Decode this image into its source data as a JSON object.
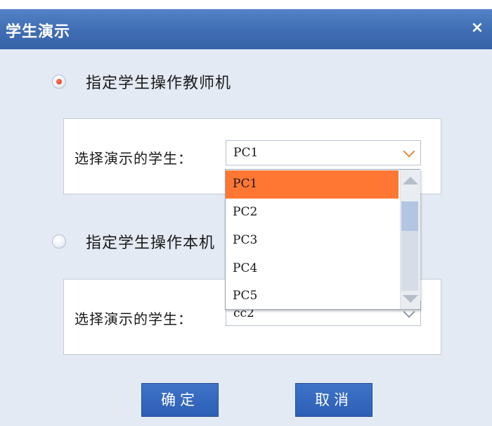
{
  "dialog": {
    "title": "学生演示",
    "close_symbol": "×"
  },
  "option_teacher": {
    "label": "指定学生操作教师机",
    "selected": true,
    "field_label": "选择演示的学生：",
    "select_value": "PC1"
  },
  "option_local": {
    "label": "指定学生操作本机",
    "selected": false,
    "field_label": "选择演示的学生：",
    "select_value": "cc2"
  },
  "dropdown": {
    "options": [
      "PC1",
      "PC2",
      "PC3",
      "PC4",
      "PC5"
    ],
    "selected_index": 0
  },
  "buttons": {
    "ok": "确定",
    "cancel": "取消"
  },
  "colors": {
    "titlebar": "#4674bb",
    "selected_option": "#ff7733",
    "button": "#3467bd",
    "dialog_bg": "#e4eaf4"
  },
  "icons": {
    "close": "close-icon",
    "radio_selected": "radio-selected-icon",
    "radio_unselected": "radio-unselected-icon",
    "dropdown_chevron": "chevron-down-icon",
    "scroll_up": "scroll-up-arrow-icon",
    "scroll_down": "scroll-down-arrow-icon"
  }
}
